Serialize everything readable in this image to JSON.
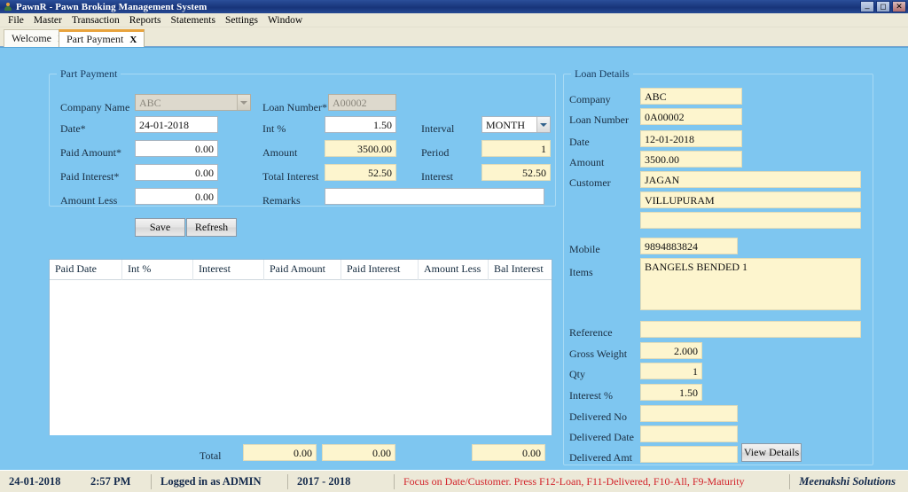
{
  "window": {
    "title": "PawnR - Pawn Broking Management System",
    "icon": "user-icon",
    "minimize": "_",
    "maximize": "❐",
    "close": "✕"
  },
  "menu": {
    "items": [
      "File",
      "Master",
      "Transaction",
      "Reports",
      "Statements",
      "Settings",
      "Window"
    ]
  },
  "tabs": [
    {
      "label": "Welcome",
      "close": "X",
      "active": false
    },
    {
      "label": "Part Payment",
      "close": "X",
      "active": true
    }
  ],
  "part_payment": {
    "legend": "Part Payment",
    "company_name": {
      "label": "Company Name",
      "value": "ABC",
      "disabled": true
    },
    "date": {
      "label": "Date*",
      "value": "24-01-2018"
    },
    "paid_amount": {
      "label": "Paid Amount*",
      "value": "0.00"
    },
    "paid_interest": {
      "label": "Paid Interest*",
      "value": "0.00"
    },
    "amount_less": {
      "label": "Amount Less",
      "value": "0.00"
    },
    "loan_number": {
      "label": "Loan Number*",
      "value": "A00002",
      "disabled": true
    },
    "int_pct": {
      "label": "Int %",
      "value": "1.50"
    },
    "amount": {
      "label": "Amount",
      "value": "3500.00"
    },
    "total_interest": {
      "label": "Total Interest",
      "value": "52.50"
    },
    "remarks": {
      "label": "Remarks",
      "value": ""
    },
    "interval": {
      "label": "Interval",
      "value": "MONTH"
    },
    "period": {
      "label": "Period",
      "value": "1"
    },
    "interest": {
      "label": "Interest",
      "value": "52.50"
    },
    "save_label": "Save",
    "refresh_label": "Refresh"
  },
  "loan_details": {
    "legend": "Loan Details",
    "company": {
      "label": "Company",
      "value": "ABC"
    },
    "loan_number": {
      "label": "Loan Number",
      "value": "0A00002"
    },
    "date": {
      "label": "Date",
      "value": "12-01-2018"
    },
    "amount": {
      "label": "Amount",
      "value": "3500.00"
    },
    "customer": {
      "label": "Customer",
      "line1": "JAGAN",
      "line2": "VILLUPURAM",
      "line3": ""
    },
    "mobile": {
      "label": "Mobile",
      "value": "9894883824"
    },
    "items": {
      "label": "Items",
      "value": "BANGELS BENDED 1"
    },
    "reference": {
      "label": "Reference",
      "value": ""
    },
    "gross_weight": {
      "label": "Gross Weight",
      "value": "2.000"
    },
    "qty": {
      "label": "Qty",
      "value": "1"
    },
    "interest_pct": {
      "label": "Interest %",
      "value": "1.50"
    },
    "delivered_no": {
      "label": "Delivered No",
      "value": ""
    },
    "delivered_date": {
      "label": "Delivered Date",
      "value": ""
    },
    "delivered_amt": {
      "label": "Delivered Amt",
      "value": ""
    },
    "view_details_label": "View Details"
  },
  "grid": {
    "columns": [
      "Paid Date",
      "Int %",
      "Interest",
      "Paid Amount",
      "Paid Interest",
      "Amount Less",
      "Bal Interest"
    ],
    "rows": [],
    "total_label": "Total",
    "total_interest": "0.00",
    "total_paid_amount": "0.00",
    "total_bal_interest": "0.00"
  },
  "statusbar": {
    "date": "24-01-2018",
    "time": "2:57 PM",
    "logged_in": "Logged in as  ADMIN",
    "fiscal_year": "2017  -  2018",
    "hint": "Focus on Date/Customer. Press F12-Loan, F11-Delivered, F10-All, F9-Maturity",
    "brand": "Meenakshi Solutions"
  },
  "colors": {
    "client_bg": "#7ec6f0",
    "readonly_field": "#fdf5ce",
    "accent_tab": "#e8a33d",
    "status_hint": "#d2232a",
    "titlebar": "#1b3a80"
  }
}
